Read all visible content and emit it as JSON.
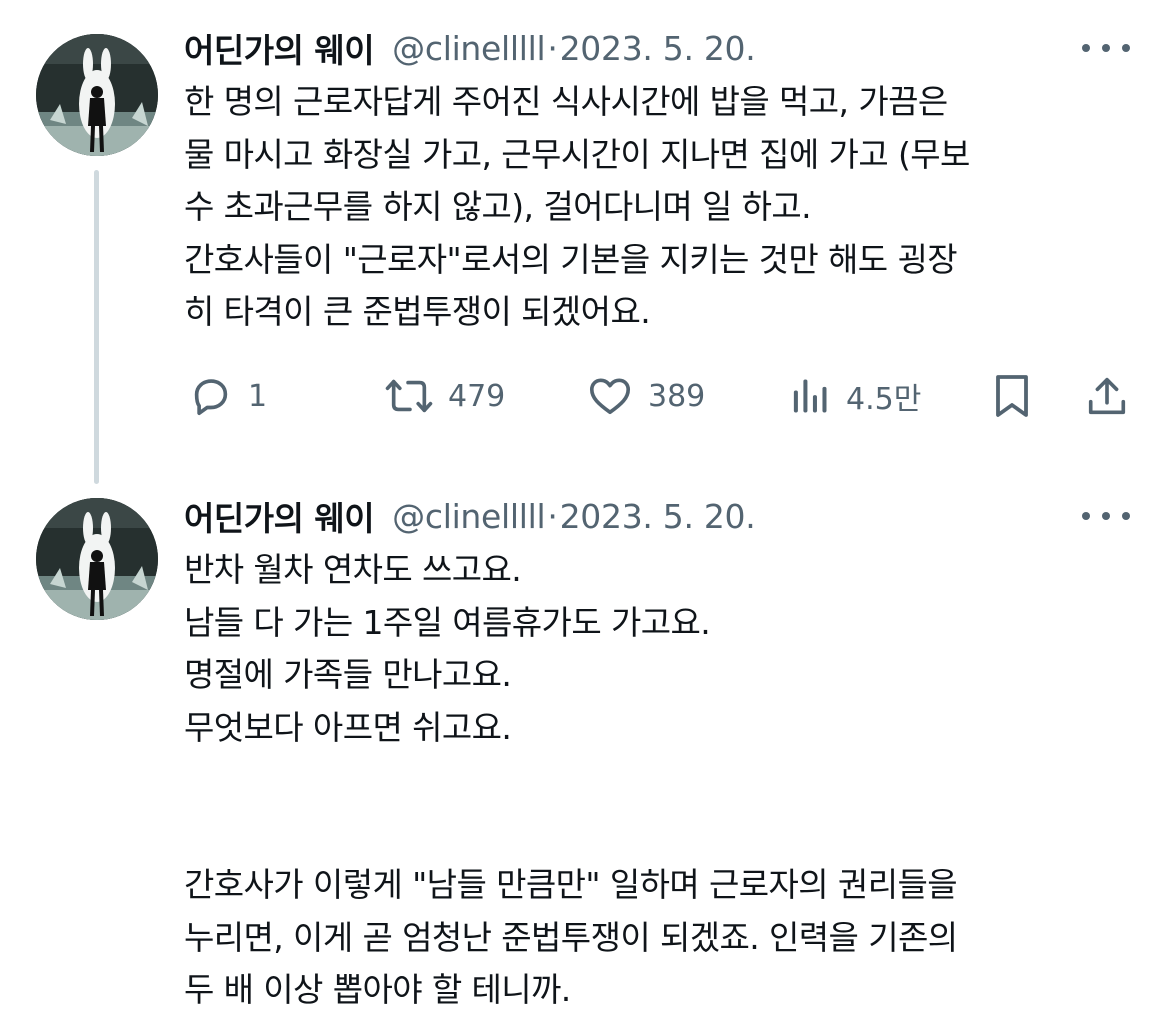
{
  "tweets": [
    {
      "display_name": "어딘가의 웨이",
      "handle": "@clinelllll",
      "separator": "·",
      "date": "2023. 5. 20.",
      "avatar_icon": "avatar-silhouette-icon",
      "lines": [
        "한 명의 근로자답게 주어진 식사시간에 밥을 먹고, 가끔은",
        "물 마시고 화장실 가고, 근무시간이 지나면 집에 가고 (무보",
        "수 초과근무를 하지 않고), 걸어다니며 일 하고.",
        "간호사들이 \"근로자\"로서의 기본을 지키는 것만 해도 굉장",
        "히 타격이 큰 준법투쟁이 되겠어요."
      ],
      "actions": {
        "reply_count": "1",
        "retweet_count": "479",
        "like_count": "389",
        "view_count": "4.5만"
      }
    },
    {
      "display_name": "어딘가의 웨이",
      "handle": "@clinelllll",
      "separator": "·",
      "date": "2023. 5. 20.",
      "avatar_icon": "avatar-silhouette-icon",
      "lines": [
        "반차 월차 연차도 쓰고요.",
        "남들 다 가는 1주일 여름휴가도 가고요.",
        "명절에 가족들 만나고요.",
        "무엇보다 아프면 쉬고요.",
        "",
        "간호사가 이렇게 \"남들 만큼만\" 일하며 근로자의 권리들을",
        "누리면, 이게 곧 엄청난 준법투쟁이 되겠죠. 인력을 기존의",
        "두 배 이상 뽑아야 할 테니까."
      ]
    }
  ],
  "icons": {
    "reply": "reply-bubble-icon",
    "retweet": "retweet-arrows-icon",
    "like": "heart-icon",
    "views": "bar-chart-icon",
    "bookmark": "bookmark-icon",
    "share": "share-upload-icon",
    "more": "more-dots-icon"
  },
  "colors": {
    "text_primary": "#0f1419",
    "text_secondary": "#536471",
    "thread_line": "#cfd9de"
  }
}
